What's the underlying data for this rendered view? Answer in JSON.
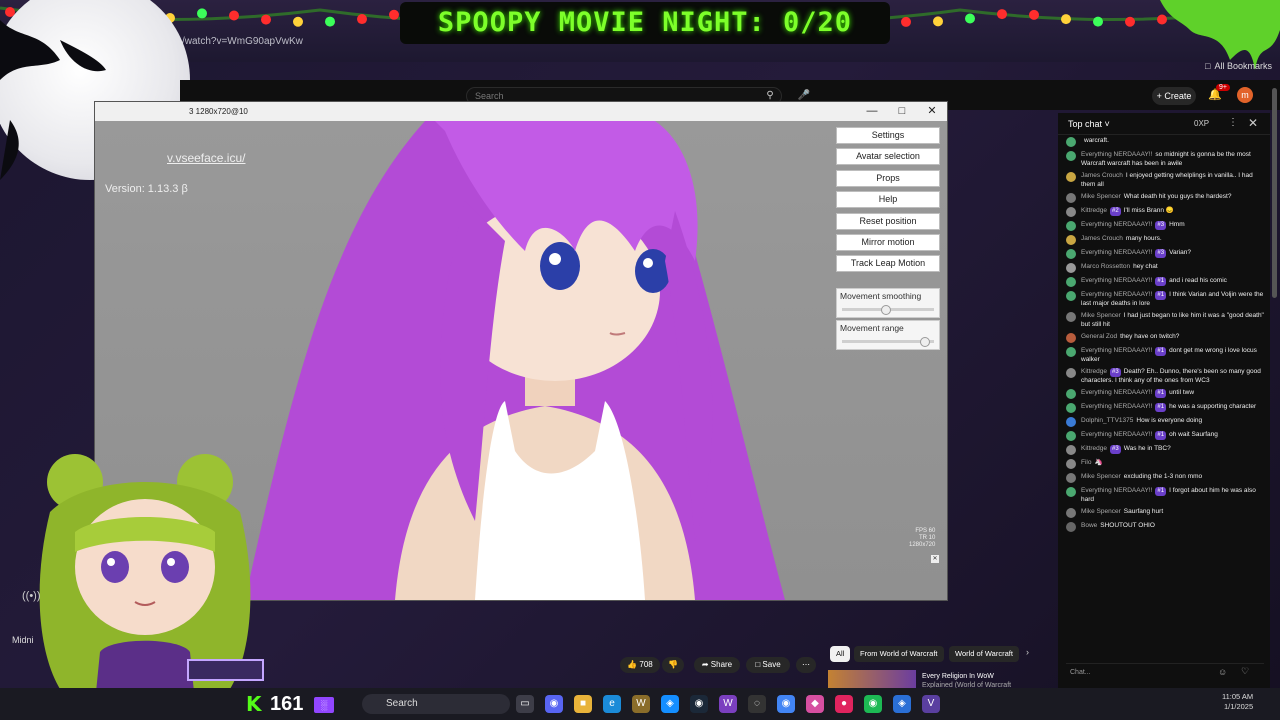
{
  "stream": {
    "title": "SPOOPY MOVIE NIGHT: 0/20"
  },
  "browser": {
    "url": "/watch?v=WmG90apVwKw",
    "bookmarks": "All Bookmarks",
    "profile_initial": "m"
  },
  "youtube": {
    "search_placeholder": "Search",
    "create_label": "Create",
    "notif_count": "9+",
    "avatar_initial": "m",
    "likes": "708",
    "share": "Share",
    "save": "Save",
    "chips": [
      "All",
      "From World of Warcraft",
      "World of Warcraft"
    ],
    "rec_title": "Every Religion In WoW",
    "rec_sub": "Explained (World of Warcraft"
  },
  "vseeface": {
    "title": "3 1280x720@10",
    "url": "v.vseeface.icu/",
    "version": "Version: 1.13.3 β",
    "buttons": [
      "Settings",
      "Avatar selection",
      "Props",
      "Help",
      "Reset position",
      "Mirror motion",
      "Track Leap Motion"
    ],
    "movement_smoothing_label": "Movement smoothing",
    "movement_smoothing_value": 0.48,
    "movement_range_label": "Movement range",
    "movement_range_value": 0.95,
    "fps": "FPS 60",
    "tr": "TR  10",
    "res": "1280x720"
  },
  "chat": {
    "header": "Top chat",
    "xp": "0XP",
    "input_placeholder": "Chat...",
    "messages": [
      {
        "name": "",
        "badge": "",
        "text": "warcraft.",
        "color": "#4aa870"
      },
      {
        "name": "Everything NERDAAAY!!",
        "badge": "",
        "text": "so midnight is gonna be the most Warcraft warcraft has been in awile",
        "color": "#4aa870"
      },
      {
        "name": "James Crouch",
        "badge": "",
        "text": "I enjoyed getting whelplings in vanilla.. I had them all",
        "color": "#c9a642"
      },
      {
        "name": "Mike Spencer",
        "badge": "",
        "text": "What death hit you guys the hardest?",
        "color": "#777"
      },
      {
        "name": "Kittredge",
        "badge": "#2",
        "text": "I'll miss Brann 😞",
        "color": "#888"
      },
      {
        "name": "Everything NERDAAAY!!",
        "badge": "#3",
        "text": "Hmm",
        "color": "#4aa870"
      },
      {
        "name": "James Crouch",
        "badge": "",
        "text": "many hours.",
        "color": "#c9a642"
      },
      {
        "name": "Everything NERDAAAY!!",
        "badge": "#3",
        "text": "Varian?",
        "color": "#4aa870"
      },
      {
        "name": "Marco Rossetton",
        "badge": "",
        "text": "hey chat",
        "color": "#999"
      },
      {
        "name": "Everything NERDAAAY!!",
        "badge": "#1",
        "text": "and i read his comic",
        "color": "#4aa870"
      },
      {
        "name": "Everything NERDAAAY!!",
        "badge": "#1",
        "text": "I think Varian and Voljin were the last major deaths in lore",
        "color": "#4aa870"
      },
      {
        "name": "Mike Spencer",
        "badge": "",
        "text": "I had just began to like him it was a \"good death\" but still hit",
        "color": "#777"
      },
      {
        "name": "General Zod",
        "badge": "",
        "text": "they have on twitch?",
        "color": "#b85c3c"
      },
      {
        "name": "Everything NERDAAAY!!",
        "badge": "#1",
        "text": "dont get me wrong i love locus walker",
        "color": "#4aa870"
      },
      {
        "name": "Kittredge",
        "badge": "#3",
        "text": "Death? Eh.. Dunno, there's been so many good characters. I think any of the ones from WC3",
        "color": "#888"
      },
      {
        "name": "Everything NERDAAAY!!",
        "badge": "#1",
        "text": "until tww",
        "color": "#4aa870"
      },
      {
        "name": "Everything NERDAAAY!!",
        "badge": "#1",
        "text": "he was a supporting character",
        "color": "#4aa870"
      },
      {
        "name": "Dolphin_TTV1375",
        "badge": "",
        "text": "How is everyone doing",
        "color": "#3a7bd5"
      },
      {
        "name": "Everything NERDAAAY!!",
        "badge": "#1",
        "text": "oh wait Saurfang",
        "color": "#4aa870"
      },
      {
        "name": "Kittredge",
        "badge": "#3",
        "text": "Was he in TBC?",
        "color": "#888"
      },
      {
        "name": "Filo",
        "badge": "",
        "text": "🦄",
        "color": "#888"
      },
      {
        "name": "Mike Spencer",
        "badge": "",
        "text": "excluding the 1-3 non mmo",
        "color": "#777"
      },
      {
        "name": "Everything NERDAAAY!!",
        "badge": "#1",
        "text": "I forgot about him he was also hard",
        "color": "#4aa870"
      },
      {
        "name": "Mike Spencer",
        "badge": "",
        "text": "Saurfang hurt",
        "color": "#777"
      },
      {
        "name": "Bowe",
        "badge": "",
        "text": "SHOUTOUT OHIO",
        "color": "#666"
      }
    ]
  },
  "left_overlay": {
    "channel": "Midni",
    "live_label": "((•))"
  },
  "taskbar": {
    "k_logo": "K",
    "count": "161",
    "search": "Search",
    "time": "11:05 AM",
    "date": "1/1/2025"
  }
}
